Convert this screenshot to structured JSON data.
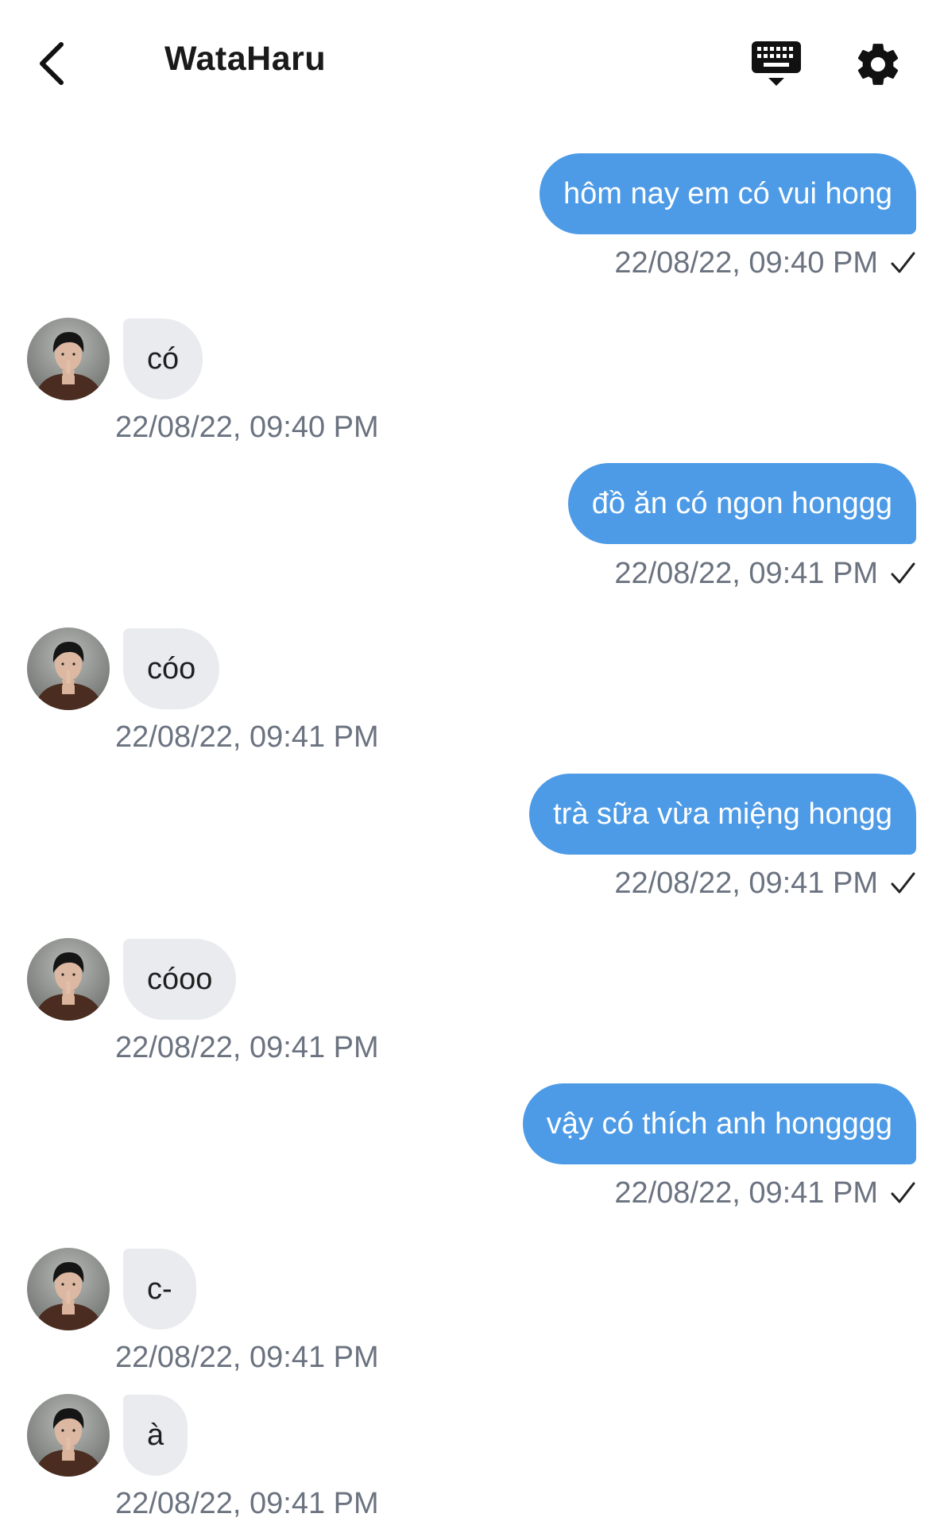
{
  "header": {
    "back_icon": "chevron-left-icon",
    "title": "WataHaru",
    "keyboard_icon": "keyboard-icon",
    "settings_icon": "gear-icon"
  },
  "colors": {
    "sent_bubble": "#4d9be6",
    "received_bubble": "#e9ebef",
    "timestamp": "#6b7380"
  },
  "messages": [
    {
      "direction": "sent",
      "text": "hôm nay em có vui hong",
      "time": "22/08/22, 09:40 PM",
      "status_icon": "check-icon"
    },
    {
      "direction": "received",
      "text": "có",
      "time": "22/08/22, 09:40 PM",
      "avatar": "avatar-image"
    },
    {
      "direction": "sent",
      "text": "đồ ăn có ngon honggg",
      "time": "22/08/22, 09:41 PM",
      "status_icon": "check-icon"
    },
    {
      "direction": "received",
      "text": "cóo",
      "time": "22/08/22, 09:41 PM",
      "avatar": "avatar-image"
    },
    {
      "direction": "sent",
      "text": "trà sữa vừa miệng hongg",
      "time": "22/08/22, 09:41 PM",
      "status_icon": "check-icon"
    },
    {
      "direction": "received",
      "text": "cóoo",
      "time": "22/08/22, 09:41 PM",
      "avatar": "avatar-image"
    },
    {
      "direction": "sent",
      "text": "vậy có thích anh hongggg",
      "time": "22/08/22, 09:41 PM",
      "status_icon": "check-icon"
    },
    {
      "direction": "received",
      "text": "c-",
      "time": "22/08/22, 09:41 PM",
      "avatar": "avatar-image"
    },
    {
      "direction": "received",
      "text": "à",
      "time": "22/08/22, 09:41 PM",
      "avatar": "avatar-image"
    }
  ]
}
